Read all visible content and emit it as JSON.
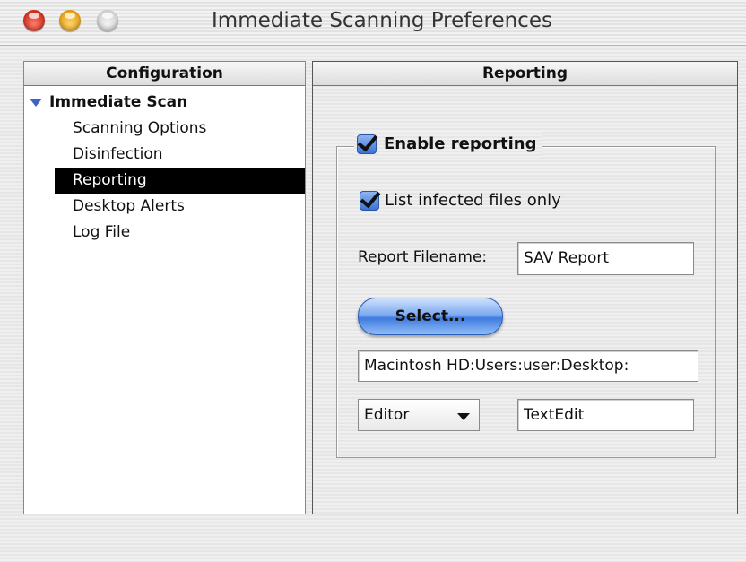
{
  "window": {
    "title": "Immediate Scanning Preferences"
  },
  "left_panel": {
    "header": "Configuration",
    "root": "Immediate Scan",
    "items": [
      {
        "label": "Scanning Options",
        "selected": false
      },
      {
        "label": "Disinfection",
        "selected": false
      },
      {
        "label": "Reporting",
        "selected": true
      },
      {
        "label": "Desktop Alerts",
        "selected": false
      },
      {
        "label": "Log File",
        "selected": false
      }
    ]
  },
  "right_panel": {
    "header": "Reporting",
    "enable_reporting": {
      "label": "Enable reporting",
      "checked": true
    },
    "list_infected": {
      "label": "List infected files only",
      "checked": true
    },
    "report_filename": {
      "label": "Report Filename:",
      "value": "SAV Report"
    },
    "select_button": "Select...",
    "path": "Macintosh HD:Users:user:Desktop:",
    "editor": {
      "selected": "Editor",
      "value": "TextEdit"
    }
  },
  "colors": {
    "accent": "#3f7be0",
    "selection": "#000000"
  }
}
